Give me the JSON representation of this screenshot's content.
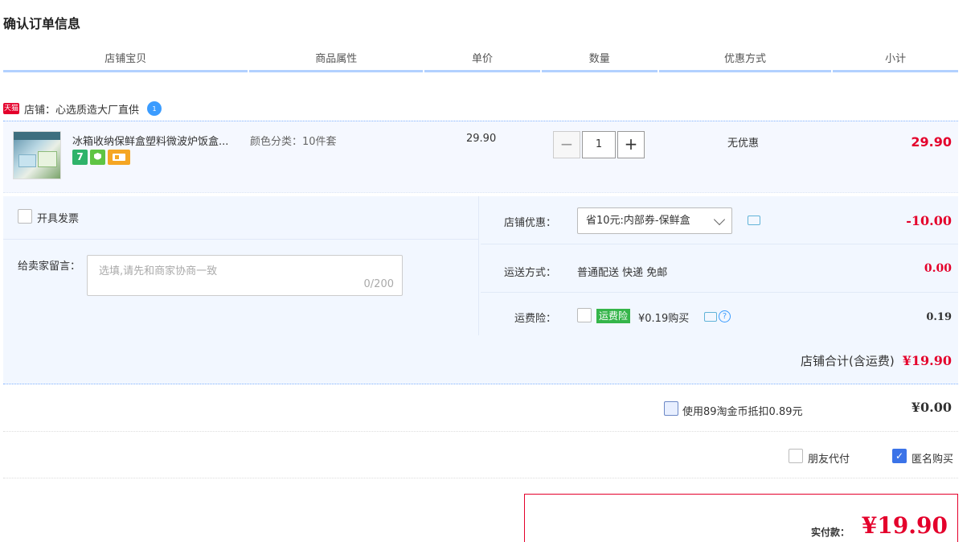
{
  "page_title": "确认订单信息",
  "columns": [
    "店铺宝贝",
    "商品属性",
    "单价",
    "数量",
    "优惠方式",
    "小计"
  ],
  "shop": {
    "badge": "天猫",
    "label": "店铺：心选质造大厂直供",
    "wangwang_badge": "1"
  },
  "item": {
    "name": "冰箱收纳保鲜盒塑料微波炉饭盒...",
    "service_icons": [
      {
        "icon": "seven-day-return-icon",
        "text": "7"
      },
      {
        "icon": "guarantee-icon",
        "text": ""
      },
      {
        "icon": "card-icon",
        "text": ""
      }
    ],
    "attribute": "颜色分类：10件套",
    "unit_price": "29.90",
    "quantity": "1",
    "qty_minus": "−",
    "qty_plus": "+",
    "discount": "无优惠",
    "subtotal": "29.90"
  },
  "invoice": {
    "label": "开具发票"
  },
  "message": {
    "label": "给卖家留言：",
    "placeholder": "选填,请先和商家协商一致",
    "count": "0/200"
  },
  "shop_discount": {
    "label": "店铺优惠：",
    "selected": "省10元:内部券-保鲜盒",
    "amount": "-10.00"
  },
  "shipping": {
    "label": "运送方式：",
    "text": "普通配送 快递 免邮",
    "amount": "0.00"
  },
  "insurance": {
    "label": "运费险：",
    "badge": "运费险",
    "price": "¥0.19购买",
    "help": "?",
    "amount": "0.19"
  },
  "shop_total": {
    "label": "店铺合计(含运费)",
    "value": "¥19.90"
  },
  "coins": {
    "label": "使用89淘金币抵扣0.89元",
    "amount": "¥0.00"
  },
  "options": {
    "friend_pay": "朋友代付",
    "anonymous": "匿名购买",
    "anonymous_checked": "✓"
  },
  "payment": {
    "label": "实付款：",
    "amount": "¥19.90"
  },
  "colors": {
    "accent_red": "#e4002b",
    "header_line": "#b2d1ff",
    "panel_bg": "#f2f7ff"
  }
}
